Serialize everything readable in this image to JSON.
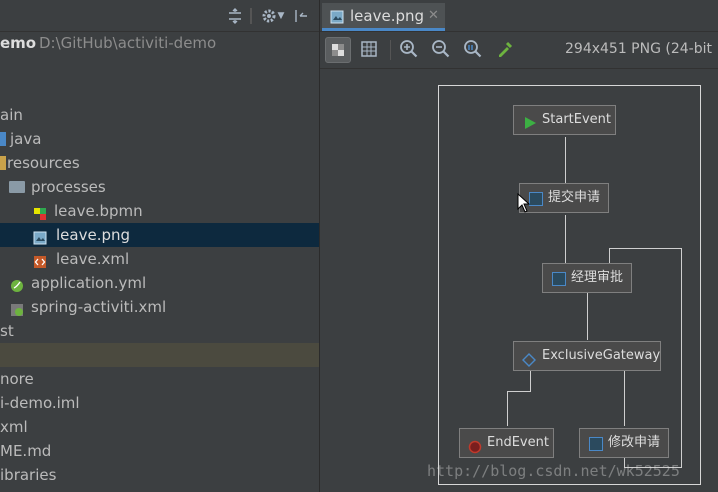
{
  "project_tree": {
    "root_name": "emo",
    "root_path": "D:\\GitHub\\activiti-demo",
    "rows": [
      {
        "label": "ain"
      },
      {
        "label": "java"
      },
      {
        "label": "resources"
      },
      {
        "label": "processes"
      },
      {
        "label": "leave.bpmn"
      },
      {
        "label": "leave.png"
      },
      {
        "label": "leave.xml"
      },
      {
        "label": "application.yml"
      },
      {
        "label": "spring-activiti.xml"
      },
      {
        "label": "st"
      },
      {
        "label": ""
      },
      {
        "label": "nore"
      },
      {
        "label": "i-demo.iml"
      },
      {
        "label": "xml"
      },
      {
        "label": "ME.md"
      },
      {
        "label": "ibraries"
      }
    ]
  },
  "editor": {
    "tab_label": "leave.png",
    "image_info": "294x451 PNG (24-bit"
  },
  "diagram": {
    "nodes": {
      "start": "StartEvent",
      "submit": "提交申请",
      "approve": "经理审批",
      "gateway": "ExclusiveGateway",
      "end": "EndEvent",
      "modify": "修改申请"
    }
  },
  "watermark": "http://blog.csdn.net/wk52525",
  "colors": {
    "panel_bg": "#3c3f41",
    "editor_bg": "#2b2b2b",
    "selection": "#0d293e",
    "tab_underline": "#4a88c7",
    "start_event": "#3cb043",
    "end_event": "#c0392b",
    "task_icon": "#4a88c7"
  }
}
